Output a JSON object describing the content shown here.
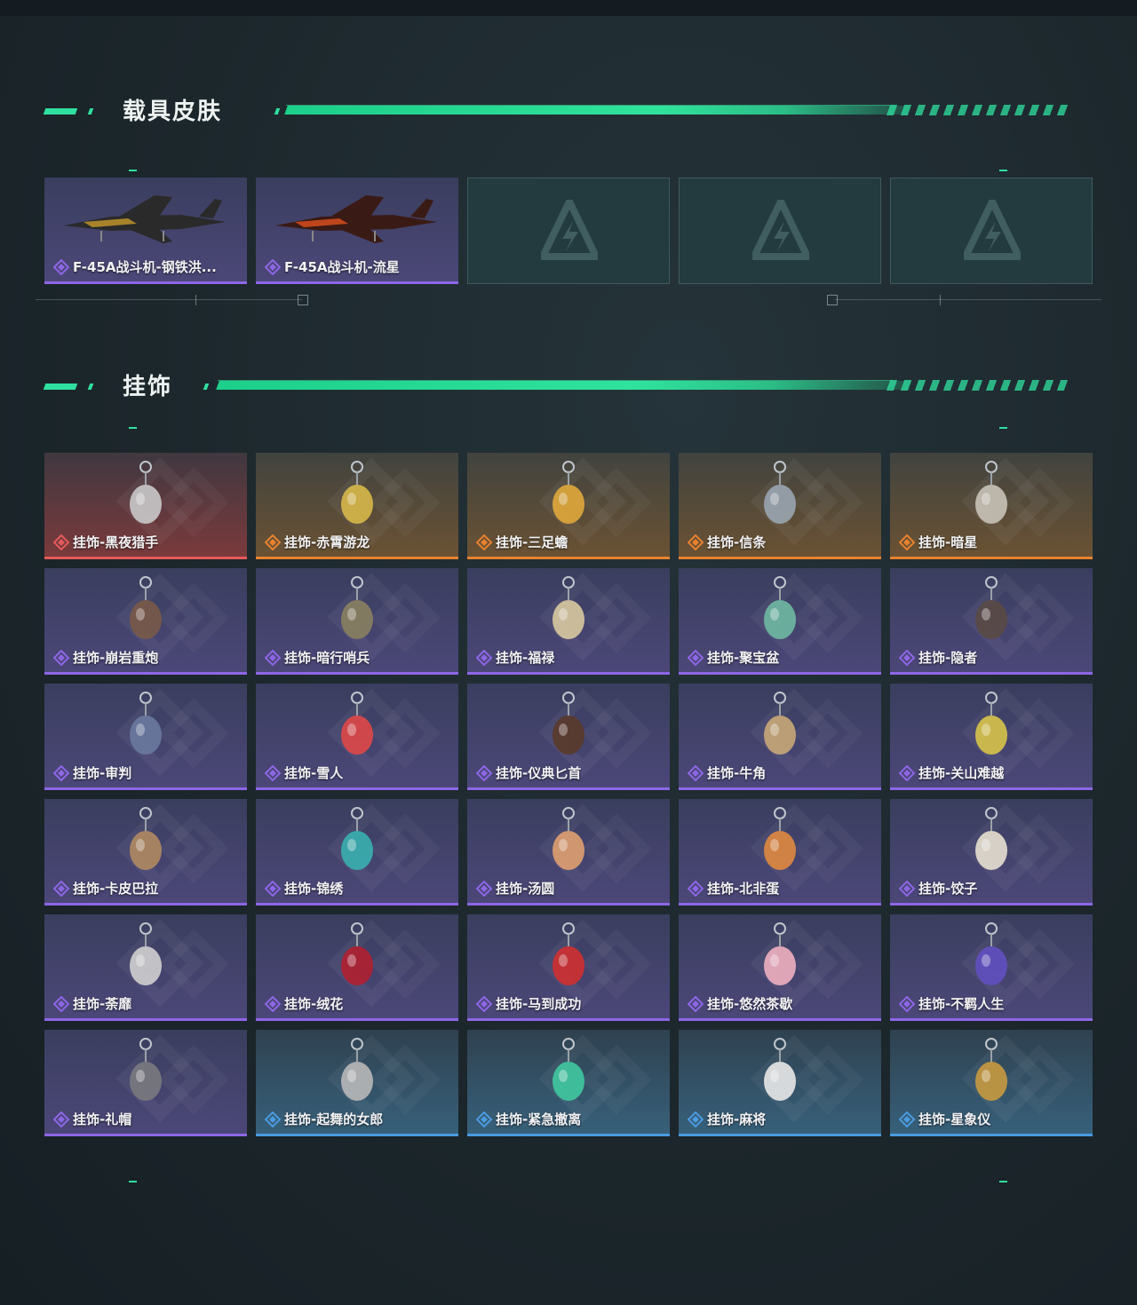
{
  "sections": {
    "vehicle_skins": {
      "title": "载具皮肤"
    },
    "pendants": {
      "title": "挂饰"
    }
  },
  "vehicle_skins": [
    {
      "label": "F-45A战斗机-钢铁洪...",
      "rarity": "purple",
      "icon": "jet-steel-icon"
    },
    {
      "label": "F-45A战斗机-流星",
      "rarity": "purple",
      "icon": "jet-meteor-icon"
    },
    {
      "label": "",
      "rarity": "empty",
      "icon": "placeholder-logo-icon"
    },
    {
      "label": "",
      "rarity": "empty",
      "icon": "placeholder-logo-icon"
    },
    {
      "label": "",
      "rarity": "empty",
      "icon": "placeholder-logo-icon"
    }
  ],
  "pendants": [
    {
      "label": "挂饰-黑夜猎手",
      "rarity": "red"
    },
    {
      "label": "挂饰-赤霄游龙",
      "rarity": "orange"
    },
    {
      "label": "挂饰-三足蟾",
      "rarity": "orange"
    },
    {
      "label": "挂饰-信条",
      "rarity": "orange"
    },
    {
      "label": "挂饰-暗星",
      "rarity": "orange"
    },
    {
      "label": "挂饰-崩岩重炮",
      "rarity": "purple"
    },
    {
      "label": "挂饰-暗行哨兵",
      "rarity": "purple"
    },
    {
      "label": "挂饰-福禄",
      "rarity": "purple"
    },
    {
      "label": "挂饰-聚宝盆",
      "rarity": "purple"
    },
    {
      "label": "挂饰-隐者",
      "rarity": "purple"
    },
    {
      "label": "挂饰-审判",
      "rarity": "purple"
    },
    {
      "label": "挂饰-雪人",
      "rarity": "purple"
    },
    {
      "label": "挂饰-仪典匕首",
      "rarity": "purple"
    },
    {
      "label": "挂饰-牛角",
      "rarity": "purple"
    },
    {
      "label": "挂饰-关山难越",
      "rarity": "purple"
    },
    {
      "label": "挂饰-卡皮巴拉",
      "rarity": "purple"
    },
    {
      "label": "挂饰-锦绣",
      "rarity": "purple"
    },
    {
      "label": "挂饰-汤圆",
      "rarity": "purple"
    },
    {
      "label": "挂饰-北非蛋",
      "rarity": "purple"
    },
    {
      "label": "挂饰-饺子",
      "rarity": "purple"
    },
    {
      "label": "挂饰-荼靡",
      "rarity": "purple"
    },
    {
      "label": "挂饰-绒花",
      "rarity": "purple"
    },
    {
      "label": "挂饰-马到成功",
      "rarity": "purple"
    },
    {
      "label": "挂饰-悠然茶歇",
      "rarity": "purple"
    },
    {
      "label": "挂饰-不羁人生",
      "rarity": "purple"
    },
    {
      "label": "挂饰-礼帽",
      "rarity": "purple"
    },
    {
      "label": "挂饰-起舞的女郎",
      "rarity": "blue"
    },
    {
      "label": "挂饰-紧急撤离",
      "rarity": "blue"
    },
    {
      "label": "挂饰-麻将",
      "rarity": "blue"
    },
    {
      "label": "挂饰-星象仪",
      "rarity": "blue"
    }
  ],
  "colors": {
    "accent": "#2fe0a0",
    "purple": "#8e66e6",
    "orange": "#e9822e",
    "red": "#e65a5a",
    "blue": "#4a9be0"
  }
}
